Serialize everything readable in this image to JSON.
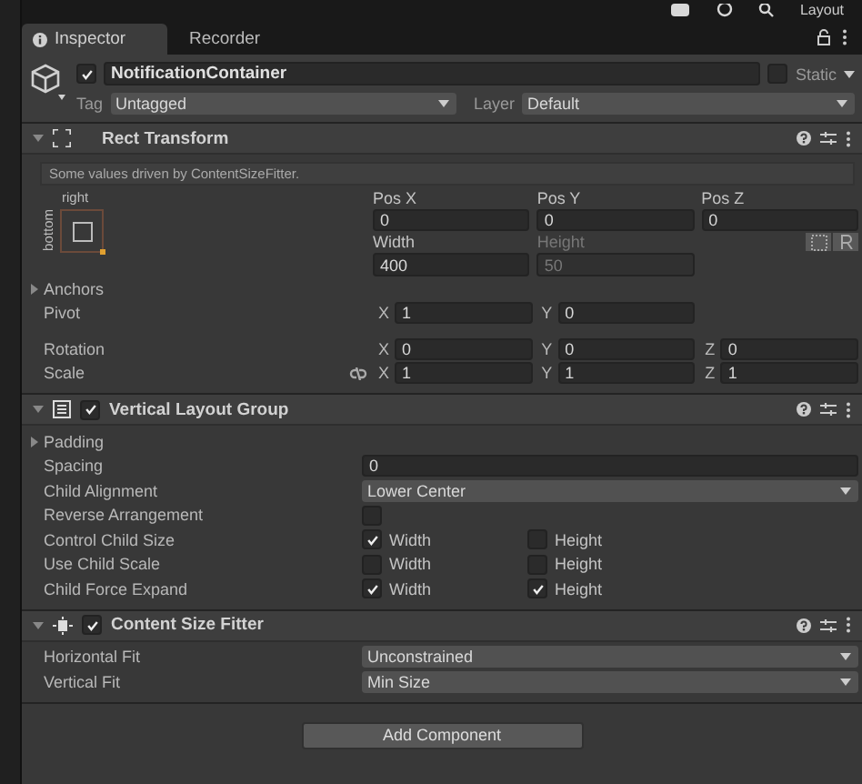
{
  "toolbar": {
    "layout_label": "Layout"
  },
  "tabs": [
    {
      "label": "Inspector",
      "selected": true
    },
    {
      "label": "Recorder",
      "selected": false
    }
  ],
  "object": {
    "active": true,
    "name": "NotificationContainer",
    "static": false,
    "static_label": "Static",
    "tag_label": "Tag",
    "tag": "Untagged",
    "layer_label": "Layer",
    "layer": "Default"
  },
  "components": [
    {
      "kind": "rect_transform",
      "title": "Rect Transform",
      "expanded": true,
      "note": "Some values driven by ContentSizeFitter.",
      "anchor_h": "right",
      "anchor_v": "bottom",
      "position_fields": [
        {
          "label": "Pos X",
          "value": "0",
          "disabled": false
        },
        {
          "label": "Pos Y",
          "value": "0",
          "disabled": false
        },
        {
          "label": "Pos Z",
          "value": "0",
          "disabled": false
        }
      ],
      "size_fields": [
        {
          "label": "Width",
          "value": "400",
          "disabled": false
        },
        {
          "label": "Height",
          "value": "50",
          "disabled": true
        }
      ],
      "anchors": {
        "label": "Anchors",
        "expanded": false
      },
      "vectors": [
        {
          "label": "Pivot",
          "axes": [
            {
              "axis": "X",
              "value": "1"
            },
            {
              "axis": "Y",
              "value": "0"
            }
          ]
        },
        {
          "label": "Rotation",
          "axes": [
            {
              "axis": "X",
              "value": "0"
            },
            {
              "axis": "Y",
              "value": "0"
            },
            {
              "axis": "Z",
              "value": "0"
            }
          ]
        },
        {
          "label": "Scale",
          "proportional": false,
          "axes": [
            {
              "axis": "X",
              "value": "1"
            },
            {
              "axis": "Y",
              "value": "1"
            },
            {
              "axis": "Z",
              "value": "1"
            }
          ]
        }
      ]
    },
    {
      "kind": "layout_group",
      "title": "Vertical Layout Group",
      "expanded": true,
      "enabled": true,
      "rows": [
        {
          "kind": "foldout",
          "label": "Padding",
          "expanded": false
        },
        {
          "kind": "number",
          "label": "Spacing",
          "value": "0"
        },
        {
          "kind": "dropdown",
          "label": "Child Alignment",
          "value": "Lower Center"
        },
        {
          "kind": "toggle",
          "label": "Reverse Arrangement",
          "checked": false
        },
        {
          "kind": "pair",
          "label": "Control Child Size",
          "options": [
            {
              "label": "Width",
              "checked": true
            },
            {
              "label": "Height",
              "checked": false
            }
          ]
        },
        {
          "kind": "pair",
          "label": "Use Child Scale",
          "options": [
            {
              "label": "Width",
              "checked": false
            },
            {
              "label": "Height",
              "checked": false
            }
          ]
        },
        {
          "kind": "pair",
          "label": "Child Force Expand",
          "options": [
            {
              "label": "Width",
              "checked": true
            },
            {
              "label": "Height",
              "checked": true
            }
          ]
        }
      ]
    },
    {
      "kind": "size_fitter",
      "title": "Content Size Fitter",
      "expanded": true,
      "enabled": true,
      "rows": [
        {
          "kind": "dropdown",
          "label": "Horizontal Fit",
          "value": "Unconstrained"
        },
        {
          "kind": "dropdown",
          "label": "Vertical Fit",
          "value": "Min Size"
        }
      ]
    }
  ],
  "add_component": "Add Component"
}
